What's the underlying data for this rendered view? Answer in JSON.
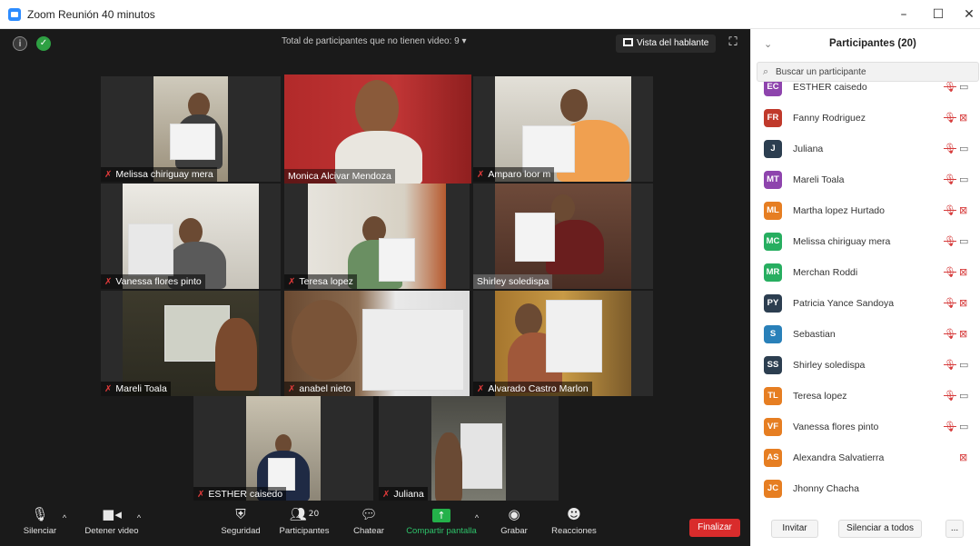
{
  "window": {
    "title": "Zoom Reunión 40 minutos",
    "minimize": "–",
    "maximize": "☐",
    "close": "✕"
  },
  "topbar": {
    "no_video_text": "Total de participantes que no tienen video: 9 ▾",
    "speaker_view": "Vista del hablante",
    "info_icon": "i",
    "shield_icon": "✓"
  },
  "tiles": [
    {
      "name": "Melissa chiriguay mera",
      "muted": true
    },
    {
      "name": "Monica Alcivar Mendoza",
      "muted": false,
      "active": true
    },
    {
      "name": "Amparo loor m",
      "muted": true
    },
    {
      "name": "Vanessa flores pinto",
      "muted": true
    },
    {
      "name": "Teresa lopez",
      "muted": true
    },
    {
      "name": "Shirley soledispa",
      "muted": false
    },
    {
      "name": "Mareli Toala",
      "muted": true
    },
    {
      "name": "anabel nieto",
      "muted": true
    },
    {
      "name": "Alvarado Castro Marlon",
      "muted": true
    },
    {
      "name": "ESTHER caisedo",
      "muted": true
    },
    {
      "name": "Juliana",
      "muted": true
    }
  ],
  "toolbar": {
    "mute": "Silenciar",
    "stop_video": "Detener video",
    "security": "Seguridad",
    "participants": "Participantes",
    "participants_count": "20",
    "chat": "Chatear",
    "share": "Compartir pantalla",
    "record": "Grabar",
    "reactions": "Reacciones",
    "end": "Finalizar"
  },
  "panel": {
    "title": "Participantes (20)",
    "search_placeholder": "Buscar un participante",
    "invite": "Invitar",
    "mute_all": "Silenciar a todos",
    "more": "..."
  },
  "participants": [
    {
      "initials": "EC",
      "name": "ESTHER caisedo",
      "color": "#8e44ad",
      "mic_muted": true,
      "cam_off": false,
      "partial": true
    },
    {
      "initials": "FR",
      "name": "Fanny Rodriguez",
      "color": "#c0392b",
      "mic_muted": true,
      "cam_off": true
    },
    {
      "initials": "J",
      "name": "Juliana",
      "color": "#2c3e50",
      "mic_muted": true,
      "cam_off": false
    },
    {
      "initials": "MT",
      "name": "Mareli Toala",
      "color": "#8e44ad",
      "mic_muted": true,
      "cam_off": false
    },
    {
      "initials": "ML",
      "name": "Martha lopez Hurtado",
      "color": "#e67e22",
      "mic_muted": true,
      "cam_off": true
    },
    {
      "initials": "MC",
      "name": "Melissa chiriguay mera",
      "color": "#27ae60",
      "mic_muted": true,
      "cam_off": false
    },
    {
      "initials": "MR",
      "name": "Merchan Roddi",
      "color": "#27ae60",
      "mic_muted": true,
      "cam_off": true
    },
    {
      "initials": "PY",
      "name": "Patricia Yance Sandoya",
      "color": "#2c3e50",
      "mic_muted": true,
      "cam_off": true
    },
    {
      "initials": "S",
      "name": "Sebastian",
      "color": "#2980b9",
      "mic_muted": true,
      "cam_off": true
    },
    {
      "initials": "SS",
      "name": "Shirley soledispa",
      "color": "#2c3e50",
      "mic_muted": true,
      "cam_off": false
    },
    {
      "initials": "TL",
      "name": "Teresa lopez",
      "color": "#e67e22",
      "mic_muted": true,
      "cam_off": false
    },
    {
      "initials": "VF",
      "name": "Vanessa flores pinto",
      "color": "#e67e22",
      "mic_muted": true,
      "cam_off": false
    },
    {
      "initials": "AS",
      "name": "Alexandra Salvatierra",
      "color": "#e67e22",
      "mic_muted": false,
      "cam_off": true
    },
    {
      "initials": "JC",
      "name": "Jhonny Chacha",
      "color": "#e67e22",
      "mic_muted": false,
      "cam_off": false
    }
  ]
}
